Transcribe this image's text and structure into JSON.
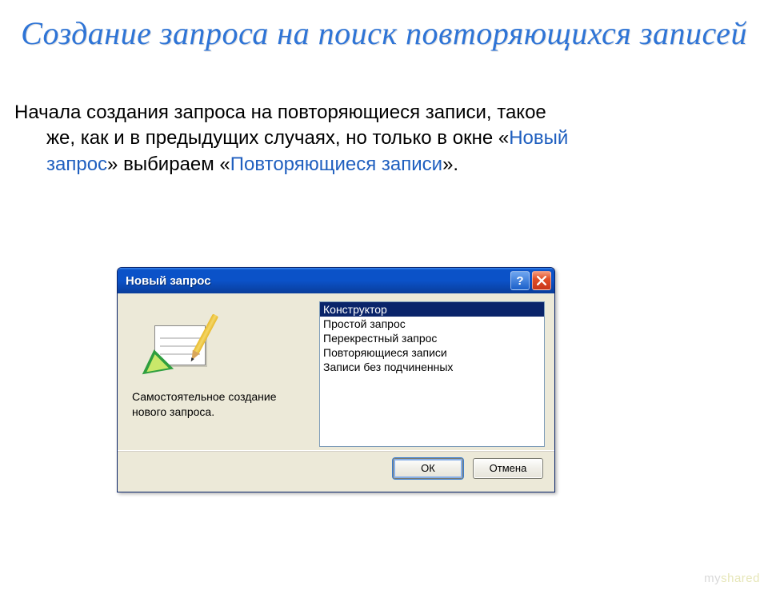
{
  "slide": {
    "title": "Создание запроса на поиск повторяющихся записей",
    "paragraph_parts": {
      "p1": "Начала создания запроса на повторяющиеся записи, такое",
      "p2a": "же, как и в предыдущих случаях, но только в окне «",
      "p2_hl": "Новый",
      "p3_hl": "запрос",
      "p3b": "» выбираем «",
      "p3_hl2": "Повторяющиеся записи",
      "p3c": "»."
    }
  },
  "dialog": {
    "title": "Новый запрос",
    "description": "Самостоятельное создание нового запроса.",
    "options": [
      "Конструктор",
      "Простой запрос",
      "Перекрестный запрос",
      "Повторяющиеся записи",
      "Записи без подчиненных"
    ],
    "selected_index": 0,
    "buttons": {
      "ok": "ОК",
      "cancel": "Отмена"
    },
    "help_symbol": "?"
  },
  "watermark": {
    "a": "my",
    "b": "shared"
  }
}
